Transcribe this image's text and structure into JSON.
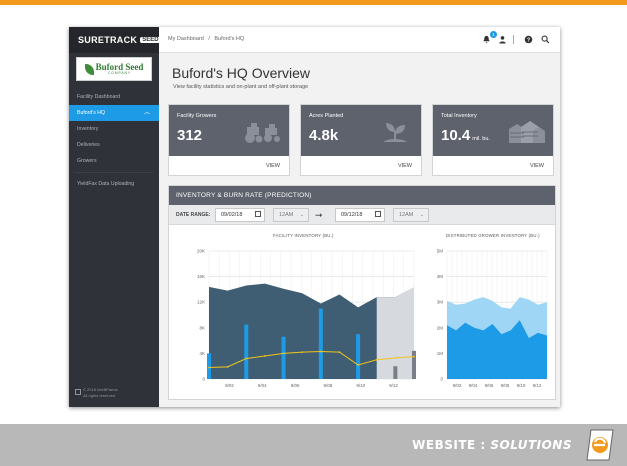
{
  "branding": {
    "app_name": "SURETRACK",
    "app_tag": "SEED",
    "client_logo_main": "Buford Seed",
    "client_logo_sub": "COMPANY"
  },
  "sidebar": {
    "items": [
      {
        "label": "Facility Dashboard"
      },
      {
        "label": "Buford's HQ",
        "active": true
      },
      {
        "label": "Inventory"
      },
      {
        "label": "Deliveries"
      },
      {
        "label": "Growers"
      },
      {
        "label": "YieldFax Data Uploading"
      }
    ],
    "copyright_line1": "© 2018 IntelliFarms",
    "copyright_line2": "All rights reserved"
  },
  "topbar": {
    "breadcrumb": [
      "My Dashboard",
      "/",
      "Buford's HQ"
    ],
    "notification_count": "1",
    "icons": [
      "bell-icon",
      "user-icon",
      "help-icon",
      "search-icon"
    ]
  },
  "page": {
    "title": "Buford's HQ Overview",
    "subtitle": "View facility statistics and on-plant and off-plant storage"
  },
  "cards": [
    {
      "label": "Facility Growers",
      "value": "312",
      "unit": "",
      "action": "VIEW",
      "icon": "tractor-icon"
    },
    {
      "label": "Acres Planted",
      "value": "4.8k",
      "unit": "",
      "action": "VIEW",
      "icon": "sprout-icon"
    },
    {
      "label": "Total Inventory",
      "value": "10.4",
      "unit": "mil. bu.",
      "action": "VIEW",
      "icon": "silo-icon"
    }
  ],
  "inventory_panel": {
    "title": "INVENTORY & BURN RATE (PREDICTION)",
    "date_range_label": "DATE RANGE:",
    "start_date": "09/02/18",
    "start_time": "12AM",
    "end_date": "09/12/18",
    "end_time": "12AM"
  },
  "colors": {
    "accent": "#1e9be6",
    "sidebar": "#2f3238",
    "card": "#5d626c",
    "brand_orange": "#f39a1e",
    "line_yellow": "#f0c419"
  },
  "chart_data": [
    {
      "type": "area",
      "title": "FACILITY INVENTORY (BU.)",
      "x_ticks": [
        "9/02",
        "9/04",
        "9/06",
        "9/08",
        "9/10",
        "9/12"
      ],
      "y_ticks": [
        "0",
        "4K",
        "8K",
        "12K",
        "16K",
        "20K"
      ],
      "ylim": [
        0,
        20000
      ],
      "x": [
        1,
        2,
        3,
        4,
        5,
        6,
        7,
        8,
        9,
        10,
        11,
        12
      ],
      "series": [
        {
          "kind": "area",
          "values": [
            14400,
            13800,
            14600,
            14900,
            14100,
            13400,
            11800,
            13200,
            11200,
            12800,
            12800,
            14300
          ]
        },
        {
          "kind": "bar",
          "values": [
            4000,
            0,
            8500,
            0,
            6600,
            0,
            11000,
            0,
            7000,
            0,
            0,
            4400
          ]
        },
        {
          "kind": "bar",
          "values": [
            0,
            0,
            0,
            0,
            0,
            0,
            0,
            0,
            0,
            0,
            2000,
            0
          ]
        },
        {
          "kind": "line",
          "values": [
            1800,
            1900,
            3200,
            3600,
            4000,
            4200,
            4300,
            4200,
            2200,
            3000,
            3300,
            3500
          ]
        }
      ]
    },
    {
      "type": "area",
      "title": "DISTRIBUTED GROWER INVENTORY (BU.)",
      "x_ticks": [
        "9/02",
        "9/04",
        "9/06",
        "9/08",
        "9/10",
        "9/12"
      ],
      "y_ticks": [
        "0",
        "1M",
        "2M",
        "3M",
        "4M",
        "5M"
      ],
      "ylim": [
        0,
        5000000
      ],
      "x": [
        1,
        2,
        3,
        4,
        5,
        6,
        7,
        8,
        9,
        10,
        11,
        12
      ],
      "series": [
        {
          "kind": "area",
          "values": [
            3050000,
            2900000,
            2950000,
            3100000,
            3200000,
            3050000,
            2800000,
            2750000,
            3200000,
            3100000,
            2900000,
            3000000
          ]
        },
        {
          "kind": "area",
          "values": [
            2100000,
            1900000,
            2200000,
            2000000,
            1900000,
            2150000,
            1750000,
            1900000,
            2300000,
            1600000,
            1800000,
            1700000
          ]
        }
      ]
    }
  ]
}
